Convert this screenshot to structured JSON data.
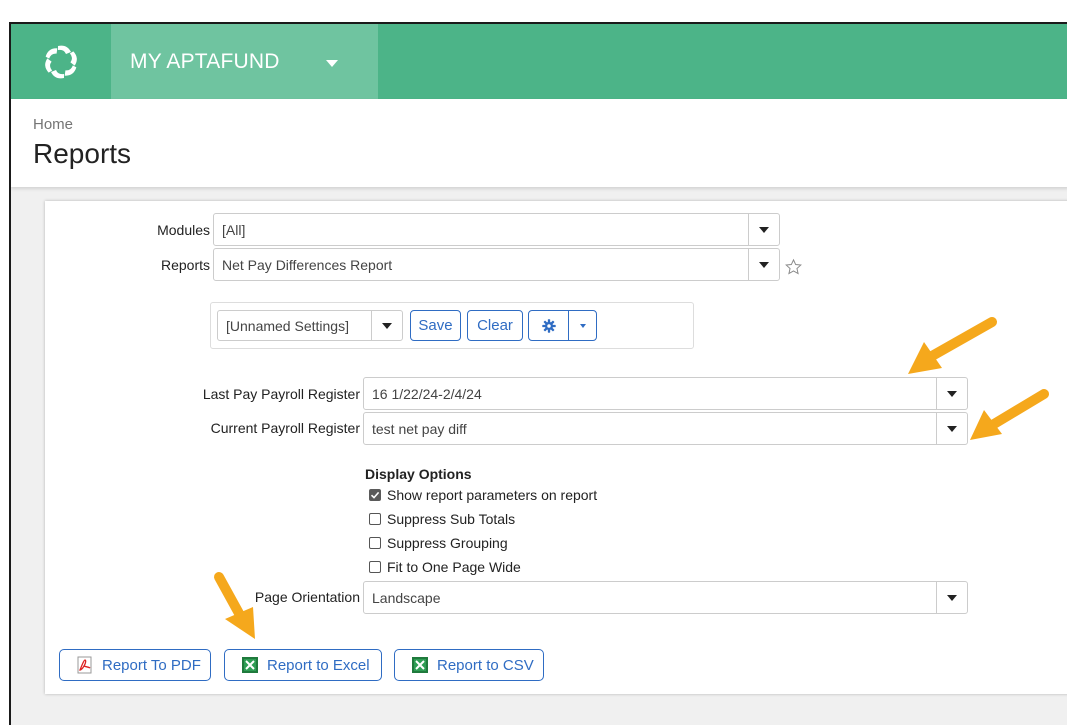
{
  "app": {
    "name": "MY APTAFUND"
  },
  "header": {
    "breadcrumb": "Home",
    "title": "Reports"
  },
  "form": {
    "modules_label": "Modules",
    "modules_value": "[All]",
    "reports_label": "Reports",
    "reports_value": "Net Pay Differences Report",
    "settings_value": "[Unnamed Settings]",
    "save_label": "Save",
    "clear_label": "Clear",
    "last_pay_label": "Last Pay Payroll Register",
    "last_pay_value": "16 1/22/24-2/4/24",
    "current_label": "Current Payroll Register",
    "current_value": "test net pay diff",
    "display_options_title": "Display Options",
    "options": [
      {
        "label": "Show report parameters on report",
        "checked": true
      },
      {
        "label": "Suppress Sub Totals",
        "checked": false
      },
      {
        "label": "Suppress Grouping",
        "checked": false
      },
      {
        "label": "Fit to One Page Wide",
        "checked": false
      }
    ],
    "orientation_label": "Page Orientation",
    "orientation_value": "Landscape"
  },
  "outputs": {
    "pdf_label": "Report To PDF",
    "excel_label": "Report to Excel",
    "csv_label": "Report to CSV"
  },
  "colors": {
    "topbar": "#4cb488",
    "app_cell": "#6fc4a0",
    "accent_blue": "#2f6cc3",
    "annotation_arrow": "#f5a81c"
  }
}
